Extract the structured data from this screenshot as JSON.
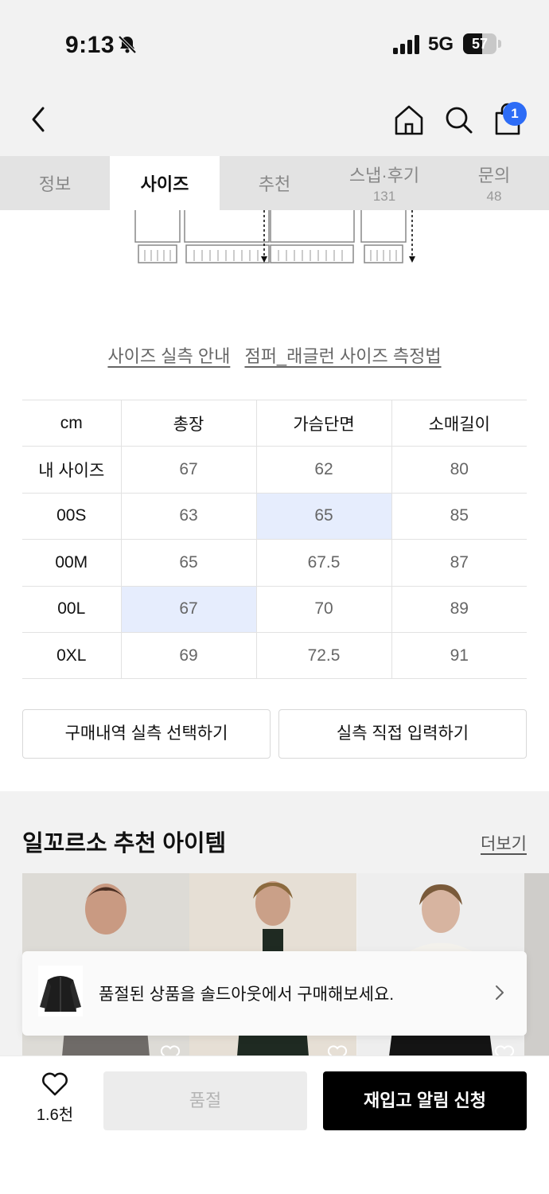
{
  "status": {
    "time": "9:13",
    "network": "5G",
    "battery": "57",
    "battery_level": 0.57
  },
  "header": {
    "cart_count": "1"
  },
  "tabs": [
    {
      "label": "정보",
      "count": ""
    },
    {
      "label": "사이즈",
      "count": ""
    },
    {
      "label": "추천",
      "count": ""
    },
    {
      "label": "스냅·후기",
      "count": "131"
    },
    {
      "label": "문의",
      "count": "48"
    }
  ],
  "links": {
    "guide": "사이즈 실측 안내",
    "method": "점퍼_래글런 사이즈 측정법"
  },
  "size_table": {
    "headers": [
      "cm",
      "총장",
      "가슴단면",
      "소매길이"
    ],
    "rows": [
      [
        "내 사이즈",
        "67",
        "62",
        "80"
      ],
      [
        "00S",
        "63",
        "65",
        "85"
      ],
      [
        "00M",
        "65",
        "67.5",
        "87"
      ],
      [
        "00L",
        "67",
        "70",
        "89"
      ],
      [
        "0XL",
        "69",
        "72.5",
        "91"
      ]
    ],
    "highlight_color": "#e6edfd"
  },
  "actions": {
    "purchase_history": "구매내역 실측 선택하기",
    "manual_input": "실측 직접 입력하기"
  },
  "recommend": {
    "title": "일꼬르소 추천 아이템",
    "more": "더보기"
  },
  "toast": {
    "message": "품절된 상품을 솔드아웃에서 구매해보세요."
  },
  "bottom": {
    "like_count": "1.6천",
    "soldout": "품절",
    "restock": "재입고 알림 신청"
  },
  "colors": {
    "accent": "#2d6cf6",
    "primary_button": "#000000"
  }
}
